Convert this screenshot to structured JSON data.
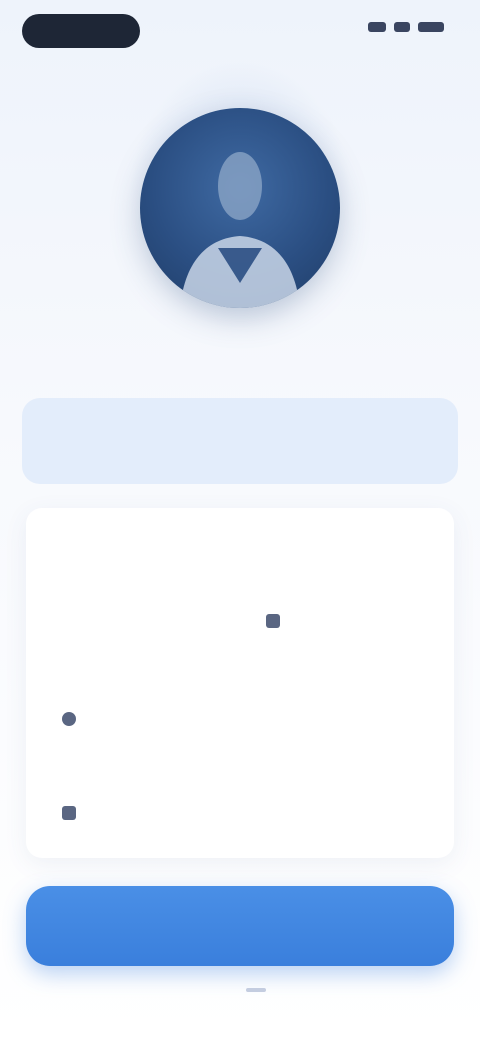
{
  "status_bar": {
    "left_pill": "",
    "right_indicators": [
      "signal-icon",
      "wifi-icon",
      "battery-icon"
    ]
  },
  "profile": {
    "avatar_icon": "user-portrait-icon",
    "name": ""
  },
  "banner": {
    "line1": "",
    "line2": ""
  },
  "details": {
    "title": "",
    "fields": [
      {
        "label": "",
        "value": ""
      },
      {
        "label": "",
        "value": ""
      },
      {
        "label": "",
        "value": ""
      },
      {
        "label": "",
        "value": ""
      },
      {
        "label": "",
        "value": ""
      }
    ]
  },
  "actions": {
    "primary_label": ""
  },
  "colors": {
    "accent": "#3a7fdc",
    "banner_bg": "#e3edfb",
    "avatar_bg": "#2b4f83"
  }
}
